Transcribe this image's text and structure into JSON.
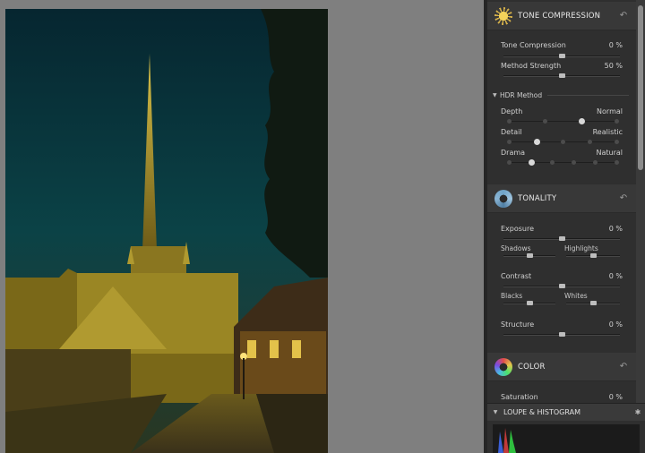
{
  "tone_compression": {
    "title": "TONE COMPRESSION",
    "tone_compression_label": "Tone Compression",
    "tone_compression_value": "0 %",
    "method_strength_label": "Method Strength",
    "method_strength_value": "50 %",
    "hdr_method_label": "HDR Method",
    "depth_label": "Depth",
    "depth_value": "Normal",
    "detail_label": "Detail",
    "detail_value": "Realistic",
    "drama_label": "Drama",
    "drama_value": "Natural"
  },
  "tonality": {
    "title": "TONALITY",
    "exposure_label": "Exposure",
    "exposure_value": "0 %",
    "shadows_label": "Shadows",
    "highlights_label": "Highlights",
    "contrast_label": "Contrast",
    "contrast_value": "0 %",
    "blacks_label": "Blacks",
    "whites_label": "Whites",
    "structure_label": "Structure",
    "structure_value": "0 %"
  },
  "color": {
    "title": "COLOR",
    "saturation_label": "Saturation",
    "saturation_value": "0 %"
  },
  "loupe": {
    "title": "LOUPE & HISTOGRAM"
  },
  "icons": {
    "tone_compression": "sun-icon",
    "tonality": "aperture-icon",
    "color": "color-wheel-icon",
    "reset": "reset-icon",
    "pin": "pin-icon"
  },
  "colors": {
    "panel_bg": "#2f2f2f",
    "header_bg": "#383838",
    "canvas_bg": "#7f7f7f"
  }
}
